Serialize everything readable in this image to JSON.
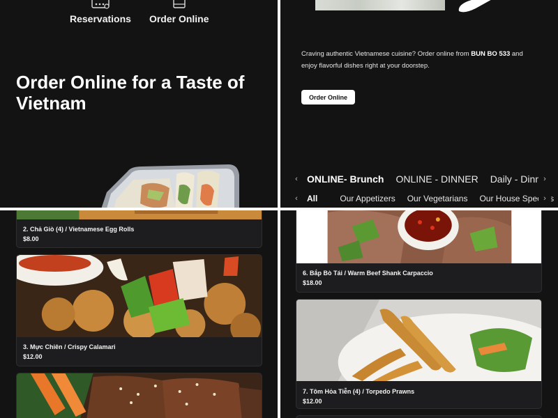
{
  "top_nav": {
    "items": [
      {
        "label": "Reservations",
        "icon": "calendar-icon"
      },
      {
        "label": "Order Online",
        "icon": "bag-icon"
      }
    ]
  },
  "hero": {
    "title": "Order Online for a Taste of Vietnam",
    "description_prefix": "Craving authentic Vietnamese cuisine? Order online from ",
    "restaurant_name": "BUN BO 533",
    "description_suffix": " and enjoy flavorful dishes right at your doorstep.",
    "order_button": "Order Online"
  },
  "menu_tabs": {
    "prev": "‹",
    "next": "›",
    "items": [
      "ONLINE- Brunch",
      "ONLINE - DINNER",
      "Daily - Dinner"
    ],
    "active": "ONLINE- Brunch"
  },
  "category_tabs": {
    "prev": "‹",
    "next": "›",
    "items": [
      "All",
      "Our Appetizers",
      "Our Vegetarians",
      "Our House Specials"
    ],
    "active": "All"
  },
  "menu_items": [
    {
      "name": "2. Chả Giò (4) / Vietnamese Egg Rolls",
      "price": "$8.00"
    },
    {
      "name": "3. Mực Chiên / Crispy Calamari",
      "price": "$12.00"
    },
    {
      "name": "6. Bắp Bò Tái / Warm Beef Shank Carpaccio",
      "price": "$18.00"
    },
    {
      "name": "7. Tôm Hỏa Tiễn (4) / Torpedo Prawns",
      "price": "$12.00"
    }
  ]
}
